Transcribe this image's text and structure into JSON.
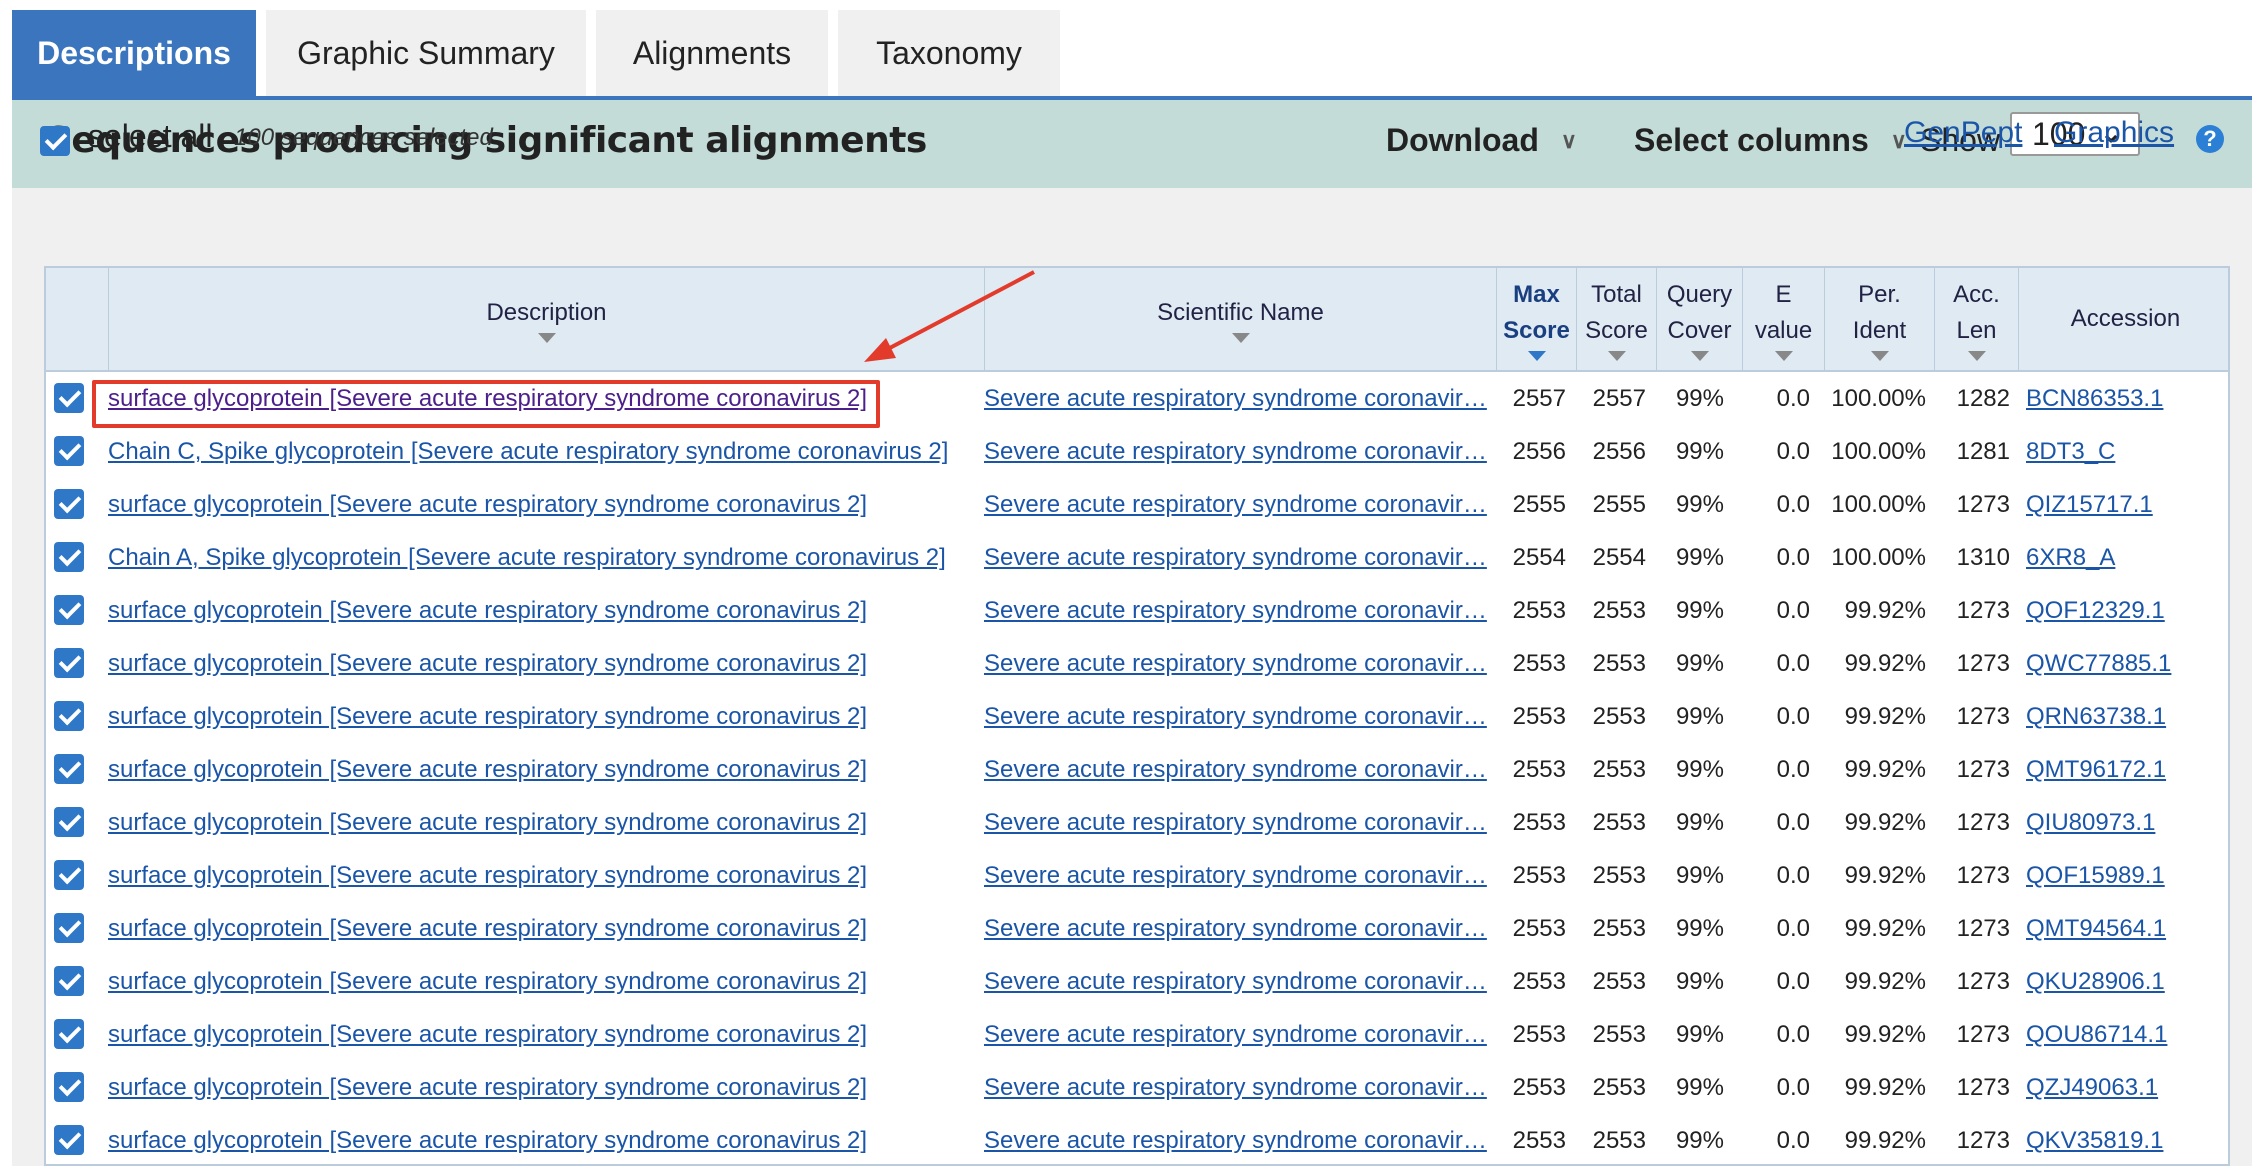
{
  "tabs": [
    {
      "label": "Descriptions",
      "active": true
    },
    {
      "label": "Graphic Summary"
    },
    {
      "label": "Alignments"
    },
    {
      "label": "Taxonomy"
    }
  ],
  "header": {
    "title": "Sequences producing significant alignments",
    "download": "Download",
    "select_columns": "Select columns",
    "show_label": "Show",
    "show_value": "100",
    "help": "?"
  },
  "selection": {
    "select_all": "select all",
    "count": "100 sequences selected",
    "genpept": "GenPept",
    "graphics": "Graphics"
  },
  "columns": {
    "description": "Description",
    "scientific_name": "Scientific Name",
    "max_score_1": "Max",
    "max_score_2": "Score",
    "total_score_1": "Total",
    "total_score_2": "Score",
    "query_cover_1": "Query",
    "query_cover_2": "Cover",
    "evalue_1": "E",
    "evalue_2": "value",
    "per_ident_1": "Per.",
    "per_ident_2": "Ident",
    "acc_len_1": "Acc.",
    "acc_len_2": "Len",
    "accession": "Accession"
  },
  "rows": [
    {
      "desc": "surface glycoprotein [Severe acute respiratory syndrome coronavirus 2]",
      "sci": "Severe acute respiratory syndrome coronavir…",
      "max": "2557",
      "total": "2557",
      "cover": "99%",
      "evalue": "0.0",
      "ident": "100.00%",
      "len": "1282",
      "acc": "BCN86353.1"
    },
    {
      "desc": "Chain C, Spike glycoprotein [Severe acute respiratory syndrome coronavirus 2]",
      "sci": "Severe acute respiratory syndrome coronavir…",
      "max": "2556",
      "total": "2556",
      "cover": "99%",
      "evalue": "0.0",
      "ident": "100.00%",
      "len": "1281",
      "acc": "8DT3_C"
    },
    {
      "desc": "surface glycoprotein [Severe acute respiratory syndrome coronavirus 2]",
      "sci": "Severe acute respiratory syndrome coronavir…",
      "max": "2555",
      "total": "2555",
      "cover": "99%",
      "evalue": "0.0",
      "ident": "100.00%",
      "len": "1273",
      "acc": "QIZ15717.1"
    },
    {
      "desc": "Chain A, Spike glycoprotein [Severe acute respiratory syndrome coronavirus 2]",
      "sci": "Severe acute respiratory syndrome coronavir…",
      "max": "2554",
      "total": "2554",
      "cover": "99%",
      "evalue": "0.0",
      "ident": "100.00%",
      "len": "1310",
      "acc": "6XR8_A"
    },
    {
      "desc": "surface glycoprotein [Severe acute respiratory syndrome coronavirus 2]",
      "sci": "Severe acute respiratory syndrome coronavir…",
      "max": "2553",
      "total": "2553",
      "cover": "99%",
      "evalue": "0.0",
      "ident": "99.92%",
      "len": "1273",
      "acc": "QOF12329.1"
    },
    {
      "desc": "surface glycoprotein [Severe acute respiratory syndrome coronavirus 2]",
      "sci": "Severe acute respiratory syndrome coronavir…",
      "max": "2553",
      "total": "2553",
      "cover": "99%",
      "evalue": "0.0",
      "ident": "99.92%",
      "len": "1273",
      "acc": "QWC77885.1"
    },
    {
      "desc": "surface glycoprotein [Severe acute respiratory syndrome coronavirus 2]",
      "sci": "Severe acute respiratory syndrome coronavir…",
      "max": "2553",
      "total": "2553",
      "cover": "99%",
      "evalue": "0.0",
      "ident": "99.92%",
      "len": "1273",
      "acc": "QRN63738.1"
    },
    {
      "desc": "surface glycoprotein [Severe acute respiratory syndrome coronavirus 2]",
      "sci": "Severe acute respiratory syndrome coronavir…",
      "max": "2553",
      "total": "2553",
      "cover": "99%",
      "evalue": "0.0",
      "ident": "99.92%",
      "len": "1273",
      "acc": "QMT96172.1"
    },
    {
      "desc": "surface glycoprotein [Severe acute respiratory syndrome coronavirus 2]",
      "sci": "Severe acute respiratory syndrome coronavir…",
      "max": "2553",
      "total": "2553",
      "cover": "99%",
      "evalue": "0.0",
      "ident": "99.92%",
      "len": "1273",
      "acc": "QIU80973.1"
    },
    {
      "desc": "surface glycoprotein [Severe acute respiratory syndrome coronavirus 2]",
      "sci": "Severe acute respiratory syndrome coronavir…",
      "max": "2553",
      "total": "2553",
      "cover": "99%",
      "evalue": "0.0",
      "ident": "99.92%",
      "len": "1273",
      "acc": "QOF15989.1"
    },
    {
      "desc": "surface glycoprotein [Severe acute respiratory syndrome coronavirus 2]",
      "sci": "Severe acute respiratory syndrome coronavir…",
      "max": "2553",
      "total": "2553",
      "cover": "99%",
      "evalue": "0.0",
      "ident": "99.92%",
      "len": "1273",
      "acc": "QMT94564.1"
    },
    {
      "desc": "surface glycoprotein [Severe acute respiratory syndrome coronavirus 2]",
      "sci": "Severe acute respiratory syndrome coronavir…",
      "max": "2553",
      "total": "2553",
      "cover": "99%",
      "evalue": "0.0",
      "ident": "99.92%",
      "len": "1273",
      "acc": "QKU28906.1"
    },
    {
      "desc": "surface glycoprotein [Severe acute respiratory syndrome coronavirus 2]",
      "sci": "Severe acute respiratory syndrome coronavir…",
      "max": "2553",
      "total": "2553",
      "cover": "99%",
      "evalue": "0.0",
      "ident": "99.92%",
      "len": "1273",
      "acc": "QOU86714.1"
    },
    {
      "desc": "surface glycoprotein [Severe acute respiratory syndrome coronavirus 2]",
      "sci": "Severe acute respiratory syndrome coronavir…",
      "max": "2553",
      "total": "2553",
      "cover": "99%",
      "evalue": "0.0",
      "ident": "99.92%",
      "len": "1273",
      "acc": "QZJ49063.1"
    },
    {
      "desc": "surface glycoprotein [Severe acute respiratory syndrome coronavirus 2]",
      "sci": "Severe acute respiratory syndrome coronavir…",
      "max": "2553",
      "total": "2553",
      "cover": "99%",
      "evalue": "0.0",
      "ident": "99.92%",
      "len": "1273",
      "acc": "QKV35819.1"
    }
  ],
  "colors": {
    "accent": "#3a75bd",
    "header_bar": "#c4dcd8",
    "link": "#1a55a8",
    "annotation": "#e23b2b"
  }
}
